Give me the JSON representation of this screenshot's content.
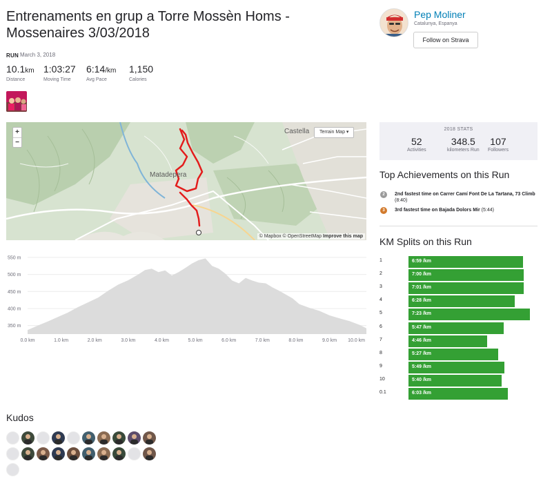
{
  "activity": {
    "title": "Entrenaments en grup a Torre Mossèn Homs - Mossenaires 3/03/2018",
    "type": "RUN",
    "date": "March 3, 2018",
    "stats": [
      {
        "value": "10.1",
        "unit": "km",
        "label": "Distance"
      },
      {
        "value": "1:03:27",
        "unit": "",
        "label": "Moving Time"
      },
      {
        "value": "6:14",
        "unit": "/km",
        "label": "Avg Pace"
      },
      {
        "value": "1,150",
        "unit": "",
        "label": "Calories"
      }
    ]
  },
  "athlete": {
    "name": "Pep Moliner",
    "location": "Catalunya, Espanya",
    "follow_label": "Follow on Strava"
  },
  "map": {
    "zoom_in": "+",
    "zoom_out": "−",
    "terrain_label": "Terrain Map",
    "attribution_prefix": "© Mapbox © OpenStreetMap",
    "attribution_link": "Improve this map",
    "places": [
      "Castella",
      "Matadepera"
    ],
    "route_color": "#e31c1c"
  },
  "year_stats": {
    "heading": "2018 STATS",
    "items": [
      {
        "value": "52",
        "label": "Activities"
      },
      {
        "value": "348.5",
        "label": "kilometers Run"
      },
      {
        "value": "107",
        "label": "Followers"
      }
    ]
  },
  "achievements": {
    "title": "Top Achievements on this Run",
    "items": [
      {
        "rank": "2",
        "medal_color": "#9a9a9a",
        "strong": "2nd fastest time on Carrer Camí Font De La Tartana, 73 Climb",
        "time": "(8:40)"
      },
      {
        "rank": "3",
        "medal_color": "#d27a2c",
        "strong": "3rd fastest time on Bajada Dolors Mir",
        "time": "(5:44)"
      }
    ]
  },
  "splits": {
    "title": "KM Splits on this Run",
    "bar_color": "#34a034",
    "rows": [
      {
        "km": "1",
        "pace": "6:59 /km",
        "seconds": 419
      },
      {
        "km": "2",
        "pace": "7:00 /km",
        "seconds": 420
      },
      {
        "km": "3",
        "pace": "7:01 /km",
        "seconds": 421
      },
      {
        "km": "4",
        "pace": "6:28 /km",
        "seconds": 388
      },
      {
        "km": "5",
        "pace": "7:23 /km",
        "seconds": 443
      },
      {
        "km": "6",
        "pace": "5:47 /km",
        "seconds": 347
      },
      {
        "km": "7",
        "pace": "4:46 /km",
        "seconds": 286
      },
      {
        "km": "8",
        "pace": "5:27 /km",
        "seconds": 327
      },
      {
        "km": "9",
        "pace": "5:49 /km",
        "seconds": 349
      },
      {
        "km": "10",
        "pace": "5:40 /km",
        "seconds": 340
      },
      {
        "km": "0.1",
        "pace": "6:03 /km",
        "seconds": 363
      }
    ]
  },
  "chart_data": {
    "type": "area",
    "title": "",
    "xlabel": "",
    "ylabel": "",
    "x_unit": "km",
    "y_unit": "m",
    "xlim": [
      0,
      10.1
    ],
    "ylim": [
      325,
      560
    ],
    "x_ticks": [
      "0.0 km",
      "1.0 km",
      "2.0 km",
      "3.0 km",
      "4.0 km",
      "5.0 km",
      "6.0 km",
      "7.0 km",
      "8.0 km",
      "9.0 km",
      "10.0 km"
    ],
    "y_ticks": [
      "350 m",
      "400 m",
      "450 m",
      "500 m",
      "550 m"
    ],
    "grid": "horizontal",
    "color": "#dcdcdc",
    "x": [
      0.0,
      0.3,
      0.6,
      0.9,
      1.2,
      1.5,
      1.8,
      2.1,
      2.4,
      2.7,
      3.0,
      3.3,
      3.5,
      3.7,
      3.9,
      4.1,
      4.3,
      4.5,
      4.7,
      4.9,
      5.1,
      5.3,
      5.5,
      5.7,
      5.9,
      6.1,
      6.3,
      6.5,
      6.7,
      6.9,
      7.1,
      7.3,
      7.5,
      7.7,
      7.9,
      8.1,
      8.4,
      8.7,
      9.0,
      9.3,
      9.6,
      9.9,
      10.1
    ],
    "y": [
      337,
      350,
      362,
      375,
      388,
      404,
      418,
      432,
      452,
      470,
      483,
      500,
      513,
      517,
      507,
      512,
      497,
      507,
      519,
      532,
      542,
      547,
      525,
      517,
      502,
      482,
      474,
      490,
      482,
      476,
      474,
      462,
      452,
      441,
      430,
      413,
      402,
      393,
      380,
      371,
      363,
      352,
      342
    ]
  },
  "kudos": {
    "title": "Kudos",
    "avatars": [
      "empty",
      "photo",
      "empty",
      "photo",
      "empty",
      "photo",
      "photo",
      "photo",
      "photo",
      "photo",
      "empty",
      "photo",
      "photo",
      "photo",
      "photo",
      "photo",
      "photo",
      "photo",
      "empty",
      "photo",
      "empty"
    ]
  }
}
